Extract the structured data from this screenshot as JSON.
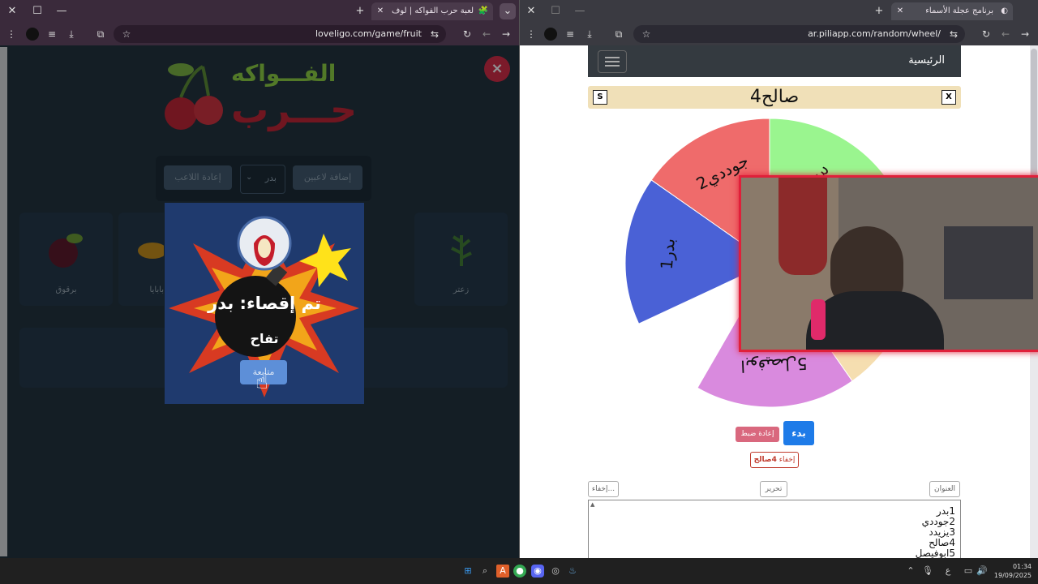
{
  "left_browser": {
    "tab_title": "لعبة حرب الفواكه | لوف ليجو يوف",
    "url": "loveligo.com/game/fruit",
    "game": {
      "logo_top": "الفـــواكه",
      "logo_bottom": "حـــرب",
      "close_label": "×",
      "add_players_label": "إضافة لاعبين",
      "player_select_value": "بدر",
      "reset_player_label": "إعادة اللاعب",
      "cards": [
        {
          "name": "زعتر",
          "icon": "thyme-icon"
        },
        {
          "name": "برقوق",
          "icon": "plum-icon"
        },
        {
          "name": "بابايا",
          "icon": "papaya-icon"
        }
      ],
      "popup": {
        "title": "تم إقصاء: بدر",
        "fruit": "تفاح",
        "continue_label": "متابعة"
      }
    }
  },
  "right_browser": {
    "tab_title": "برنامج عجلة الأسماء",
    "url": "ar.piliapp.com/random/wheel/",
    "page": {
      "nav_home": "الرئيسية",
      "result_name": "4صالح",
      "x_label": "X",
      "s_label": "S",
      "wheel_slices": [
        {
          "label": "3يزيدد",
          "color": "#9af58f"
        },
        {
          "label": "2جوددي",
          "color": "#ef6b6b"
        },
        {
          "label": "1بدر",
          "color": "#4a61d6"
        },
        {
          "label": "5ابوفيصل",
          "color": "#d98ade"
        },
        {
          "label": "4صالح",
          "color": "#f5deb0"
        }
      ],
      "start_label": "بدء",
      "reset_label": "إعادة ضبط",
      "hide_prefix": "إخفاء",
      "hide_name": "4صالح",
      "title_btn": "العنوان",
      "edit_btn": "تحرير",
      "hide_btn": "إخفاء...",
      "names_list": [
        "1بدر",
        "2جوددي",
        "3يزيدد",
        "4صالح",
        "5ابوفيصل"
      ]
    }
  },
  "taskbar": {
    "time": "01:34",
    "date": "19/09/2025",
    "lang": "ع"
  },
  "colors": {
    "start_button": "#1e7be8",
    "reset_button": "#d9687e",
    "close_badge": "#d8243c",
    "result_bar": "#f0e0b8"
  }
}
